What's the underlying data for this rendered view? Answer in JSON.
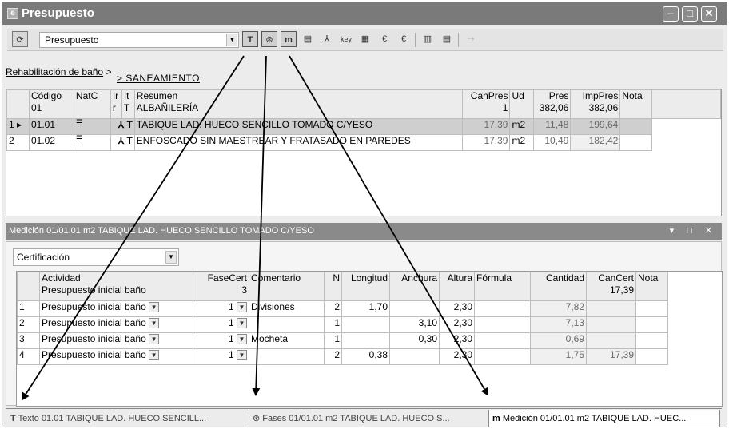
{
  "window": {
    "title": "Presupuesto",
    "app_icon": "e"
  },
  "toolbar": {
    "combo_value": "Presupuesto",
    "icons": [
      "refresh-icon",
      "text-icon",
      "phases-icon",
      "measurement-icon",
      "document-icon",
      "tree-icon",
      "key-icon",
      "grid-icon",
      "euro-icon",
      "euro-bar-icon",
      "table-icon",
      "list-icon",
      "arrow-icon"
    ]
  },
  "breadcrumb": {
    "first": "Rehabilitación de baño",
    "separator": ">",
    "second": "> SANEAMIENTO"
  },
  "grid1": {
    "headers": [
      {
        "l1": "Código",
        "l2": "01"
      },
      {
        "l1": "NatC",
        "l2": ""
      },
      {
        "l1": "Ir",
        "l2": "r"
      },
      {
        "l1": "It",
        "l2": "T"
      },
      {
        "l1": "Resumen",
        "l2": "ALBAÑILERÍA"
      },
      {
        "l1": "CanPres",
        "l2": "1"
      },
      {
        "l1": "Ud",
        "l2": ""
      },
      {
        "l1": "Pres",
        "l2": "382,06"
      },
      {
        "l1": "ImpPres",
        "l2": "382,06"
      },
      {
        "l1": "Nota",
        "l2": ""
      }
    ],
    "rows": [
      {
        "n": "1",
        "marker": "▸",
        "codigo": "01.01",
        "resumen": "TABIQUE LAD. HUECO SENCILLO TOMADO C/YESO",
        "canpres": "17,39",
        "ud": "m2",
        "pres": "11,48",
        "imppres": "199,64"
      },
      {
        "n": "2",
        "marker": "",
        "codigo": "01.02",
        "resumen": "ENFOSCADO SIN MAESTREAR Y FRATASADO EN PAREDES",
        "canpres": "17,39",
        "ud": "m2",
        "pres": "10,49",
        "imppres": "182,42"
      }
    ]
  },
  "pane": {
    "title": "Medición 01/01.01 m2 TABIQUE LAD. HUECO SENCILLO TOMADO C/YESO",
    "controls": "▾ ⊓ ✕"
  },
  "measurement": {
    "combo_value": "Certificación",
    "headers": [
      {
        "l1": "Actividad",
        "l2": "Presupuesto inicial baño"
      },
      {
        "l1": "FaseCert",
        "l2": "3"
      },
      {
        "l1": "Comentario",
        "l2": ""
      },
      {
        "l1": "N",
        "l2": ""
      },
      {
        "l1": "Longitud",
        "l2": ""
      },
      {
        "l1": "Anchura",
        "l2": ""
      },
      {
        "l1": "Altura",
        "l2": ""
      },
      {
        "l1": "Fórmula",
        "l2": ""
      },
      {
        "l1": "Cantidad",
        "l2": ""
      },
      {
        "l1": "CanCert",
        "l2": "17,39"
      },
      {
        "l1": "Nota",
        "l2": ""
      }
    ],
    "rows": [
      {
        "n": "1",
        "actividad": "Presupuesto inicial baño",
        "fase": "1",
        "comentario": "Divisiones",
        "N": "2",
        "longitud": "1,70",
        "anchura": "",
        "altura": "2,30",
        "cantidad": "7,82",
        "cancert": ""
      },
      {
        "n": "2",
        "actividad": "Presupuesto inicial baño",
        "fase": "1",
        "comentario": "",
        "N": "1",
        "longitud": "",
        "anchura": "3,10",
        "altura": "2,30",
        "cantidad": "7,13",
        "cancert": ""
      },
      {
        "n": "3",
        "actividad": "Presupuesto inicial baño",
        "fase": "1",
        "comentario": "Mocheta",
        "N": "1",
        "longitud": "",
        "anchura": "0,30",
        "altura": "2,30",
        "cantidad": "0,69",
        "cancert": ""
      },
      {
        "n": "4",
        "actividad": "Presupuesto inicial baño",
        "fase": "1",
        "comentario": "",
        "N": "2",
        "longitud": "0,38",
        "anchura": "",
        "altura": "2,30",
        "cantidad": "1,75",
        "cancert": "17,39"
      }
    ]
  },
  "tabs": [
    {
      "icon": "text-icon",
      "glyph": "T",
      "label": "Texto 01.01 TABIQUE LAD. HUECO SENCILL..."
    },
    {
      "icon": "phases-icon",
      "glyph": "⊛",
      "label": "Fases 01/01.01 m2 TABIQUE LAD. HUECO S..."
    },
    {
      "icon": "measurement-icon",
      "glyph": "m",
      "label": "Medición 01/01.01 m2 TABIQUE LAD. HUEC..."
    }
  ],
  "colors": {
    "titlebar": "#7a7a7a",
    "pane_header": "#8a8a8a",
    "selected_row": "#cfcfcf"
  }
}
